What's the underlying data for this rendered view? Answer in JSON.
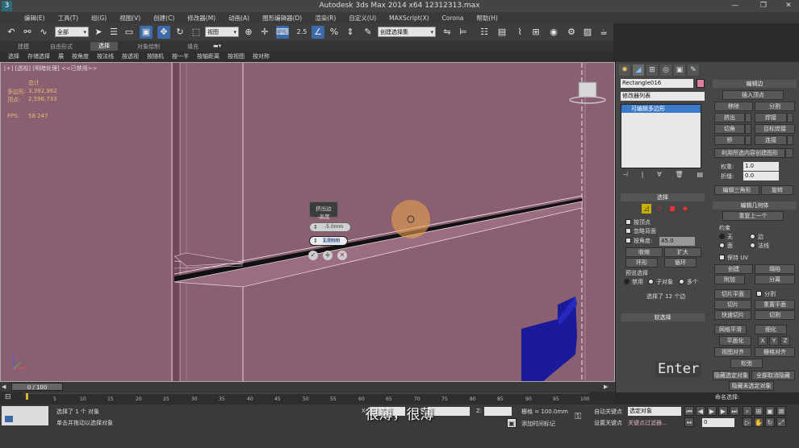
{
  "window": {
    "title": "Autodesk 3ds Max  2014 x64      12312313.max",
    "logo": "3",
    "controls": [
      "—",
      "❐",
      "✕"
    ]
  },
  "menus": [
    "编辑(E)",
    "工具(T)",
    "组(G)",
    "视图(V)",
    "创建(C)",
    "修改器(M)",
    "动画(A)",
    "图形编辑器(D)",
    "渲染(R)",
    "自定义(U)",
    "MAXScript(X)",
    "Corona",
    "帮助(H)"
  ],
  "toolbar": {
    "filter_select": "全部",
    "view_select": "视图",
    "numeric_label": "2.5",
    "named_selection": "创建选择集"
  },
  "ribbon": {
    "tabs": [
      "建模",
      "自由形式",
      "选择",
      "对象绘制",
      "填充"
    ],
    "active_tab": "选择"
  },
  "subbar_items": [
    "选择",
    "存储选择",
    "展",
    "按角度",
    "按法线",
    "按透视",
    "按随机",
    "按一半",
    "按轴距离",
    "按视图",
    "按对称"
  ],
  "viewport": {
    "label": "[+] [透视] [明暗处理] <<已禁用>>",
    "stats": {
      "header": "总计",
      "polys_label": "多边形:",
      "polys_value": "3,392,962",
      "verts_label": "顶点:",
      "verts_value": "2,596,733",
      "fps_label": "FPS:",
      "fps_value": "58.247"
    },
    "caddy": {
      "title": "挤出边",
      "subtitle": "-高度",
      "height_value": "-5.0mm",
      "width_value": "1.0mm"
    },
    "colors": {
      "background": "#8a5f72",
      "blue_object": "#1a1a9a"
    }
  },
  "command_panel": {
    "object_name": "Rectangle016",
    "object_color": "#e07fa0",
    "modifier_list": "修改器列表",
    "stack_item": "可编辑多边形",
    "edit_edges": {
      "title": "编辑边",
      "insert_vertex": "插入顶点",
      "remove": "移除",
      "split": "分割",
      "extrude": "挤出",
      "weld": "焊接",
      "chamfer": "切角",
      "target_weld": "目标焊接",
      "bridge": "桥",
      "connect": "连接",
      "create_shape": "利用所选内容创建图形",
      "weight_label": "权重:",
      "weight_value": "1.0",
      "crease_label": "折缝:",
      "crease_value": "0.0",
      "edit_tri": "编辑三角形",
      "turn": "旋转"
    },
    "selection": {
      "title": "选择",
      "by_vertex": "按顶点",
      "ignore_backfacing": "忽略背面",
      "by_angle": "按角度:",
      "angle_value": "45.0",
      "shrink": "收缩",
      "grow": "扩大",
      "ring": "环形",
      "loop": "循环",
      "preview_label": "预览选择",
      "preview_off": "禁用",
      "preview_sub": "子对象",
      "preview_multi": "多个",
      "status": "选择了 12 个边"
    },
    "soft_selection": "软选择",
    "edit_geometry": {
      "title": "编辑几何体",
      "repeat_last": "重复上一个",
      "constraints_label": "约束",
      "none": "无",
      "edge": "边",
      "face": "面",
      "normal": "法线",
      "preserve_uvs": "保持 UV",
      "create": "创建",
      "collapse": "塌陷",
      "attach": "附加",
      "detach": "分离",
      "slice_plane": "切片平面",
      "split": "分割",
      "slice": "切片",
      "reset_plane": "重置平面",
      "quickslice": "快速切片",
      "cut": "切割",
      "meshsmooth": "网格平滑",
      "tessellate": "细化",
      "make_planar": "平面化",
      "x": "X",
      "y": "Y",
      "z": "Z",
      "view_align": "视图对齐",
      "grid_align": "栅格对齐",
      "relax": "松弛",
      "hide_selected": "隐藏选定对象",
      "unhide_all": "全部取消隐藏",
      "hide_unselected": "隐藏未选定对象",
      "named_sel_label": "命名选择:"
    }
  },
  "timeline": {
    "frame_display": "0 / 100",
    "ticks": [
      "5",
      "10",
      "15",
      "20",
      "25",
      "30",
      "35",
      "40",
      "45",
      "50",
      "55",
      "60",
      "65",
      "70",
      "75",
      "80",
      "85",
      "90",
      "95",
      "100"
    ]
  },
  "status": {
    "selected": "选择了 1 个 对象",
    "prompt": "单击并拖动以选择对象",
    "x_label": "X:",
    "y_label": "Y:",
    "z_label": "Z:",
    "grid": "栅格 = 100.0mm",
    "auto_key": "自动关键点",
    "selected_obj": "选定对象",
    "set_key": "设置关键点",
    "key_filters": "关键点过滤器...",
    "add_time_tag": "添加时间标记",
    "frame_value": "0"
  },
  "overlay": {
    "subtitle": "很薄，很薄",
    "key_hint": "Enter"
  }
}
